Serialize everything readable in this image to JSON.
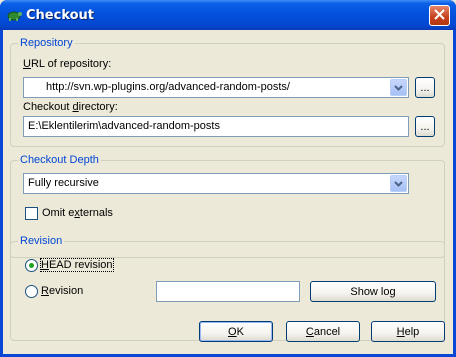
{
  "window": {
    "title": "Checkout",
    "title_icon": "tortoise-svn-icon",
    "close_icon": "close-icon"
  },
  "repository": {
    "legend": "Repository",
    "url_label": "URL of repository:",
    "url_value": "http://svn.wp-plugins.org/advanced-random-posts/",
    "url_browse": "...",
    "dir_label": "Checkout directory:",
    "dir_value": "E:\\Eklentilerim\\advanced-random-posts",
    "dir_browse": "..."
  },
  "depth": {
    "legend": "Checkout Depth",
    "selected": "Fully recursive",
    "omit_externals_label": "Omit externals",
    "omit_externals_checked": false
  },
  "revision": {
    "legend": "Revision",
    "head_label": "HEAD revision",
    "head_selected": true,
    "revision_label": "Revision",
    "revision_value": "",
    "show_log": "Show log"
  },
  "buttons": {
    "ok": "OK",
    "cancel": "Cancel",
    "help": "Help"
  },
  "colors": {
    "titlebar": "#0350dc",
    "dialog_bg": "#ece9d8",
    "group_legend": "#0046d5"
  }
}
